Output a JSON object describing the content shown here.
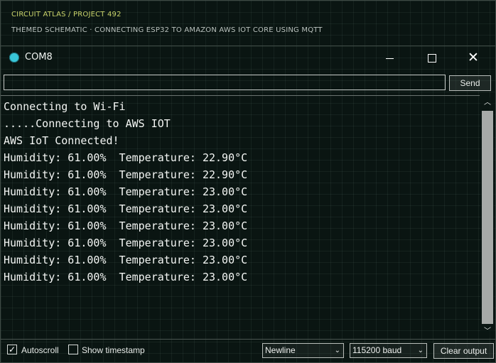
{
  "header": {
    "breadcrumb": "CIRCUIT ATLAS / PROJECT 492",
    "subtitle": "THEMED SCHEMATIC · CONNECTING ESP32 TO AMAZON AWS IOT CORE USING MQTT"
  },
  "window": {
    "title": "COM8",
    "minimize_glyph": "",
    "close_glyph": "✕"
  },
  "send": {
    "input_value": "",
    "button_label": "Send"
  },
  "output": {
    "lines": [
      "Connecting to Wi-Fi",
      ".....Connecting to AWS IOT",
      "AWS IoT Connected!",
      "Humidity: 61.00%  Temperature: 22.90°C",
      "Humidity: 61.00%  Temperature: 22.90°C",
      "Humidity: 61.00%  Temperature: 23.00°C",
      "Humidity: 61.00%  Temperature: 23.00°C",
      "Humidity: 61.00%  Temperature: 23.00°C",
      "Humidity: 61.00%  Temperature: 23.00°C",
      "Humidity: 61.00%  Temperature: 23.00°C",
      "Humidity: 61.00%  Temperature: 23.00°C"
    ]
  },
  "scrollbar": {
    "up_glyph": "︿",
    "down_glyph": "﹀"
  },
  "footer": {
    "autoscroll_label": "Autoscroll",
    "autoscroll_checked": true,
    "timestamp_label": "Show timestamp",
    "timestamp_checked": false,
    "checkmark": "✓",
    "line_ending": "Newline",
    "baud_rate": "115200 baud",
    "chevron": "⌄",
    "clear_label": "Clear output"
  },
  "colors": {
    "background": "#0a1512",
    "accent": "#c9d36a",
    "app_icon": "#39c6d8",
    "text": "#f4f6f4"
  }
}
